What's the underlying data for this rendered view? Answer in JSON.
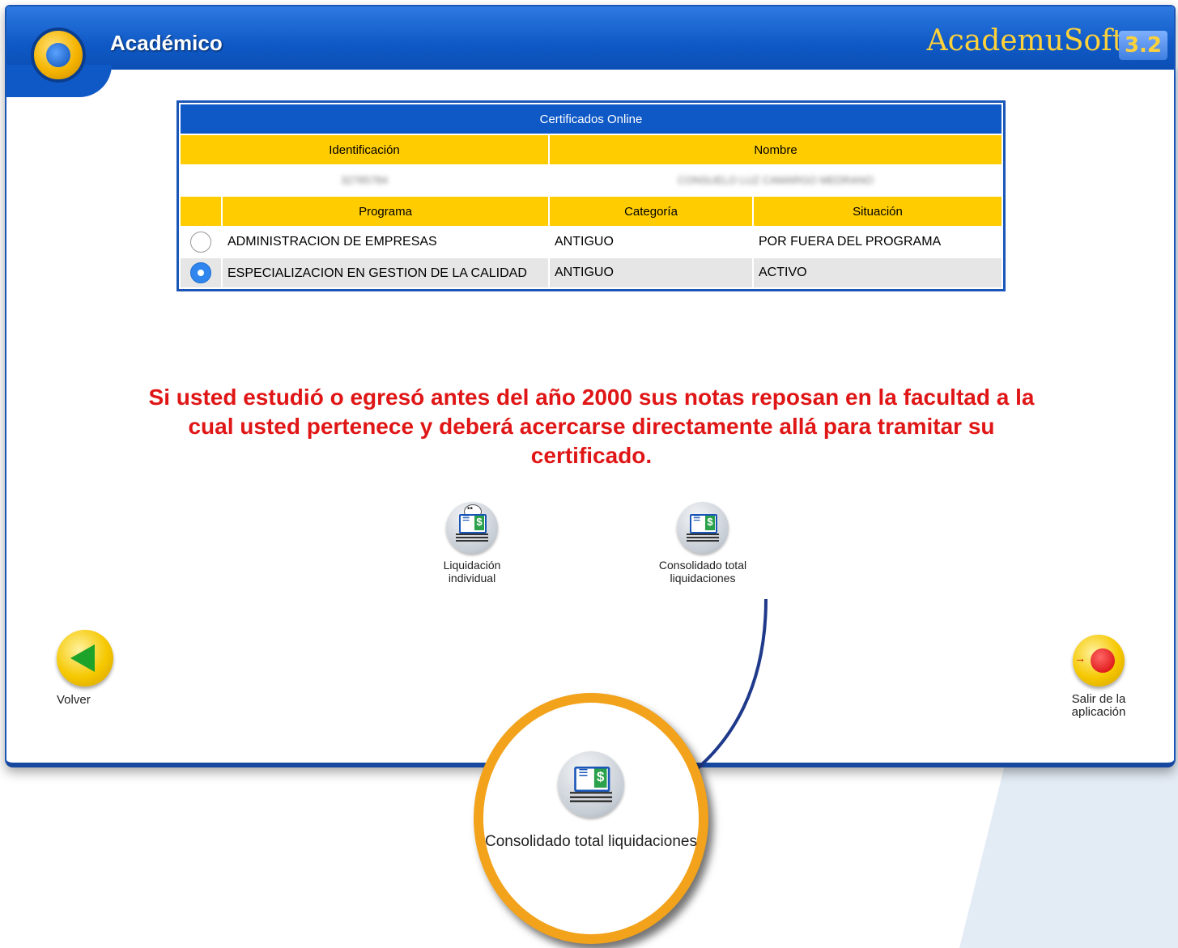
{
  "header": {
    "app_title": "Académico",
    "brand": "AcademuSoft",
    "version": "3.2"
  },
  "certificates": {
    "title": "Certificados Online",
    "id_header": "Identificación",
    "name_header": "Nombre",
    "id_value": "32785784",
    "name_value": "CONSUELO LUZ CAMARGO MEDRANO",
    "columns": [
      "Programa",
      "Categoría",
      "Situación"
    ],
    "rows": [
      {
        "program": "ADMINISTRACION DE EMPRESAS",
        "category": "ANTIGUO",
        "status": "POR FUERA DEL PROGRAMA",
        "selected": false
      },
      {
        "program": "ESPECIALIZACION EN GESTION DE LA CALIDAD",
        "category": "ANTIGUO",
        "status": "ACTIVO",
        "selected": true
      }
    ]
  },
  "warning_text": "Si usted estudió o egresó antes del año 2000 sus notas reposan en la facultad a la cual usted pertenece y deberá acercarse directamente allá para tramitar su certificado.",
  "actions": {
    "individual_label": "Liquidación individual",
    "consolidated_label": "Consolidado total liquidaciones"
  },
  "nav": {
    "back_label": "Volver",
    "exit_label": "Salir de la aplicación"
  },
  "callout": {
    "label": "Consolidado total liquidaciones"
  },
  "colors": {
    "primary_blue": "#0f59c6",
    "header_yellow": "#ffcc00",
    "warning_red": "#e01616",
    "callout_orange": "#f2a21b",
    "connector_navy": "#1f3a8a"
  }
}
